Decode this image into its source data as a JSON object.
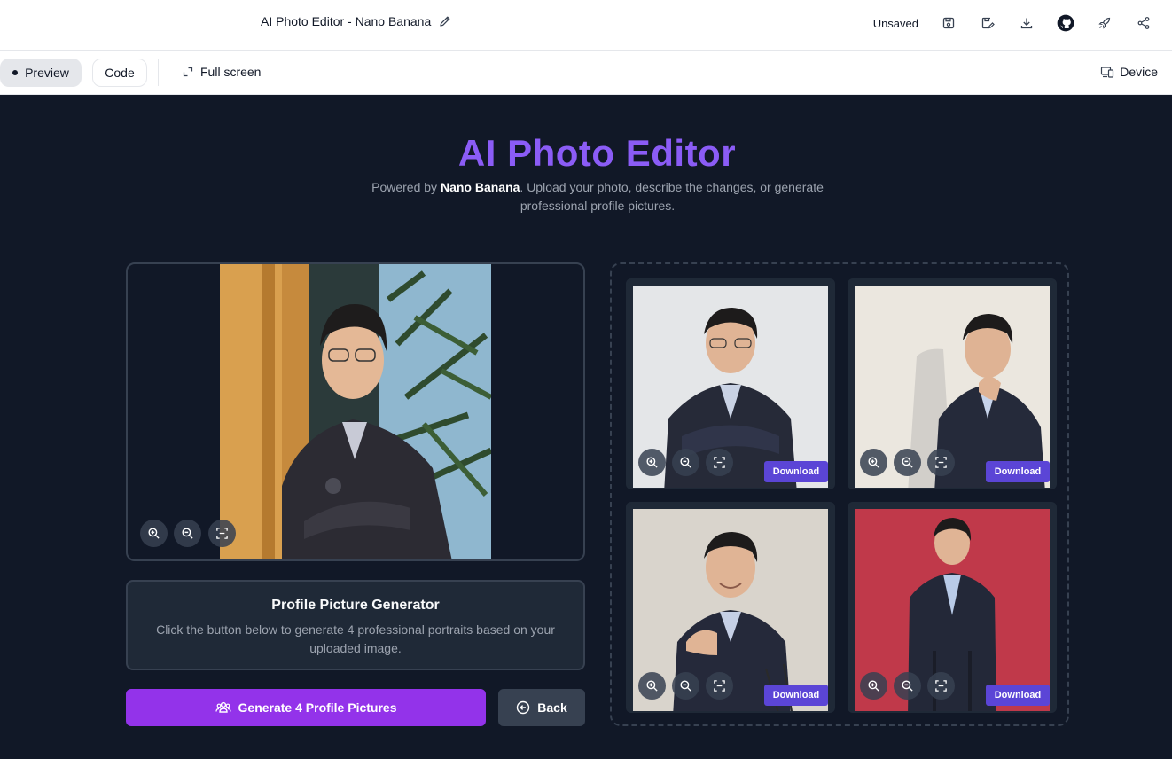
{
  "topbar": {
    "doc_title": "AI Photo Editor - Nano Banana",
    "status": "Unsaved",
    "icons": [
      "save-icon",
      "save-as-icon",
      "download-icon",
      "github-icon",
      "rocket-icon",
      "share-icon"
    ]
  },
  "subbar": {
    "preview_label": "Preview",
    "code_label": "Code",
    "fullscreen_label": "Full screen",
    "device_label": "Device"
  },
  "app": {
    "title": "AI Photo Editor",
    "subtitle_prefix": "Powered by ",
    "subtitle_brand": "Nano Banana",
    "subtitle_suffix": ". Upload your photo, describe the changes, or generate professional profile pictures.",
    "generator": {
      "heading": "Profile Picture Generator",
      "description": "Click the button below to generate 4 professional portraits based on your uploaded image."
    },
    "generate_button": "Generate 4 Profile Pictures",
    "back_button": "Back",
    "results": [
      {
        "download_label": "Download",
        "bg": "#e4e6e8"
      },
      {
        "download_label": "Download",
        "bg": "#ebe7df"
      },
      {
        "download_label": "Download",
        "bg": "#d9d4cc"
      },
      {
        "download_label": "Download",
        "bg": "#c0394a"
      }
    ]
  },
  "colors": {
    "app_bg": "#111827",
    "accent_title": "#8b5cf6",
    "generate_button": "#9333ea",
    "download_button": "#5b45d6"
  }
}
